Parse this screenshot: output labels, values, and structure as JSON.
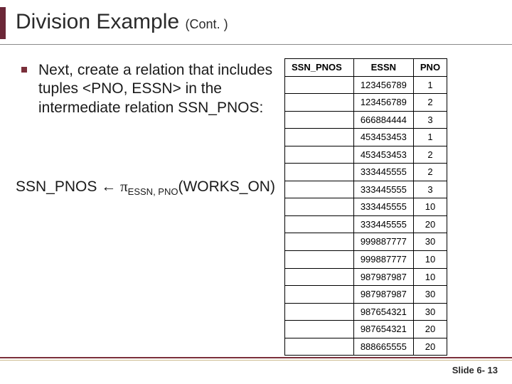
{
  "title": {
    "main": "Division Example",
    "sub": "(Cont. )"
  },
  "bullet_text": "Next, create a relation that includes tuples <PNO, ESSN> in the intermediate relation SSN_PNOS:",
  "formula": {
    "lhs": "SSN_PNOS",
    "arrow": "←",
    "pi": "π",
    "sub": "ESSN, PNO",
    "arg": "(WORKS_ON)"
  },
  "table": {
    "headers": [
      "SSN_PNOS",
      "ESSN",
      "PNO"
    ],
    "rows": [
      [
        "",
        "123456789",
        "1"
      ],
      [
        "",
        "123456789",
        "2"
      ],
      [
        "",
        "666884444",
        "3"
      ],
      [
        "",
        "453453453",
        "1"
      ],
      [
        "",
        "453453453",
        "2"
      ],
      [
        "",
        "333445555",
        "2"
      ],
      [
        "",
        "333445555",
        "3"
      ],
      [
        "",
        "333445555",
        "10"
      ],
      [
        "",
        "333445555",
        "20"
      ],
      [
        "",
        "999887777",
        "30"
      ],
      [
        "",
        "999887777",
        "10"
      ],
      [
        "",
        "987987987",
        "10"
      ],
      [
        "",
        "987987987",
        "30"
      ],
      [
        "",
        "987654321",
        "30"
      ],
      [
        "",
        "987654321",
        "20"
      ],
      [
        "",
        "888665555",
        "20"
      ]
    ]
  },
  "footer": {
    "slide_label": "Slide 6- 13"
  }
}
